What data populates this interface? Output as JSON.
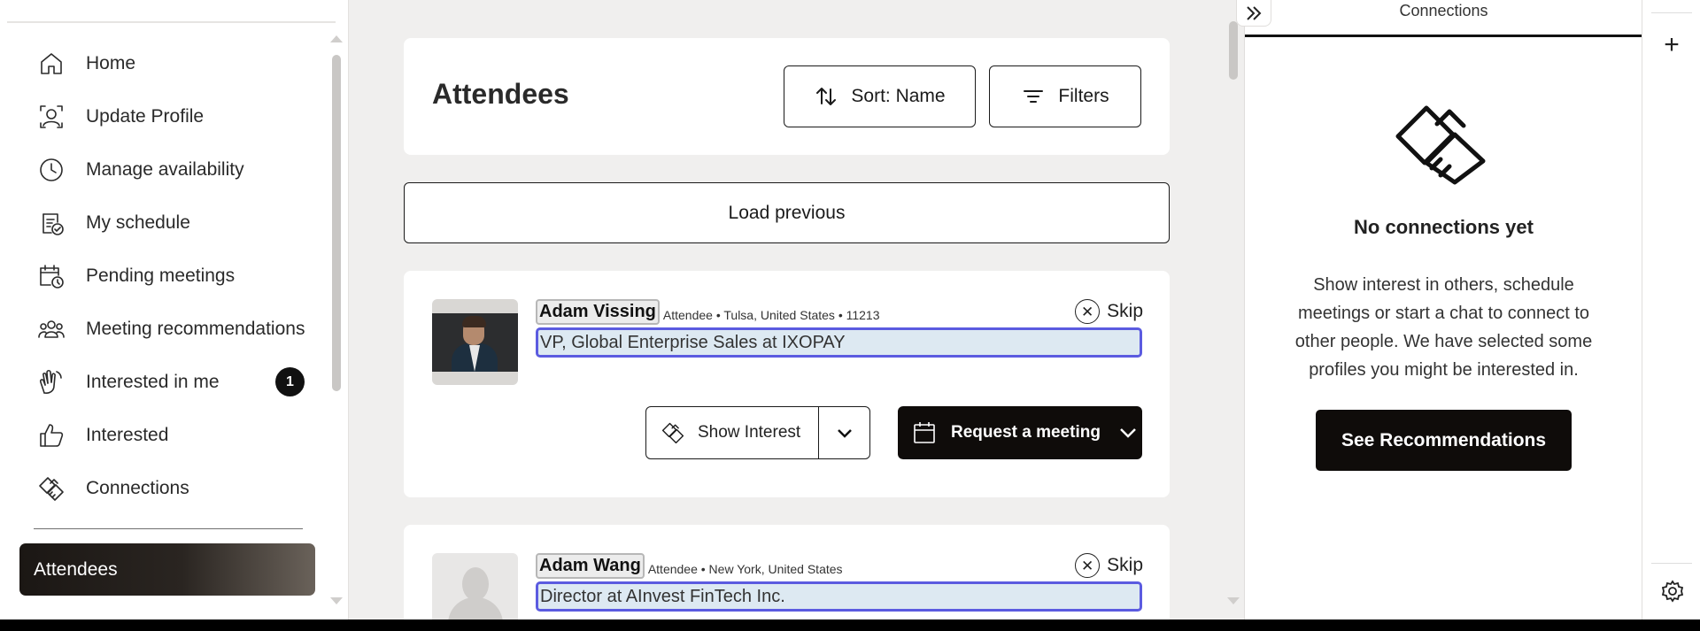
{
  "sidebar": {
    "items": [
      {
        "label": "Home",
        "icon": "home-icon"
      },
      {
        "label": "Update Profile",
        "icon": "profile-icon"
      },
      {
        "label": "Manage availability",
        "icon": "clock-icon"
      },
      {
        "label": "My schedule",
        "icon": "schedule-icon"
      },
      {
        "label": "Pending meetings",
        "icon": "pending-calendar-icon"
      },
      {
        "label": "Meeting recommendations",
        "icon": "people-icon"
      },
      {
        "label": "Interested in me",
        "icon": "waving-hands-icon",
        "badge": "1"
      },
      {
        "label": "Interested",
        "icon": "thumbs-up-icon"
      },
      {
        "label": "Connections",
        "icon": "handshake-icon"
      }
    ],
    "active": "Attendees"
  },
  "main": {
    "title": "Attendees",
    "sort_label": "Sort: Name",
    "filters_label": "Filters",
    "load_previous": "Load previous",
    "attendees": [
      {
        "name": "Adam Vissing",
        "meta": "Attendee • Tulsa, United States • 11213",
        "title": "VP, Global Enterprise Sales at IXOPAY",
        "skip": "Skip",
        "show_interest": "Show Interest",
        "request_meeting": "Request a meeting"
      },
      {
        "name": "Adam Wang",
        "meta": "Attendee • New York, United States",
        "title": "Director at AInvest FinTech Inc.",
        "skip": "Skip"
      }
    ]
  },
  "connections": {
    "tab_label": "Connections",
    "empty_title": "No connections yet",
    "empty_text": "Show interest in others, schedule meetings or start a chat to connect to other people. We have selected some profiles you might be interested in.",
    "cta": "See Recommendations"
  },
  "rail": {
    "plus": "+"
  },
  "colors": {
    "accent_dark": "#0f0c0a",
    "highlight_border": "#5b5be0",
    "highlight_bg": "#dde9f2",
    "page_bg": "#f0efee"
  }
}
